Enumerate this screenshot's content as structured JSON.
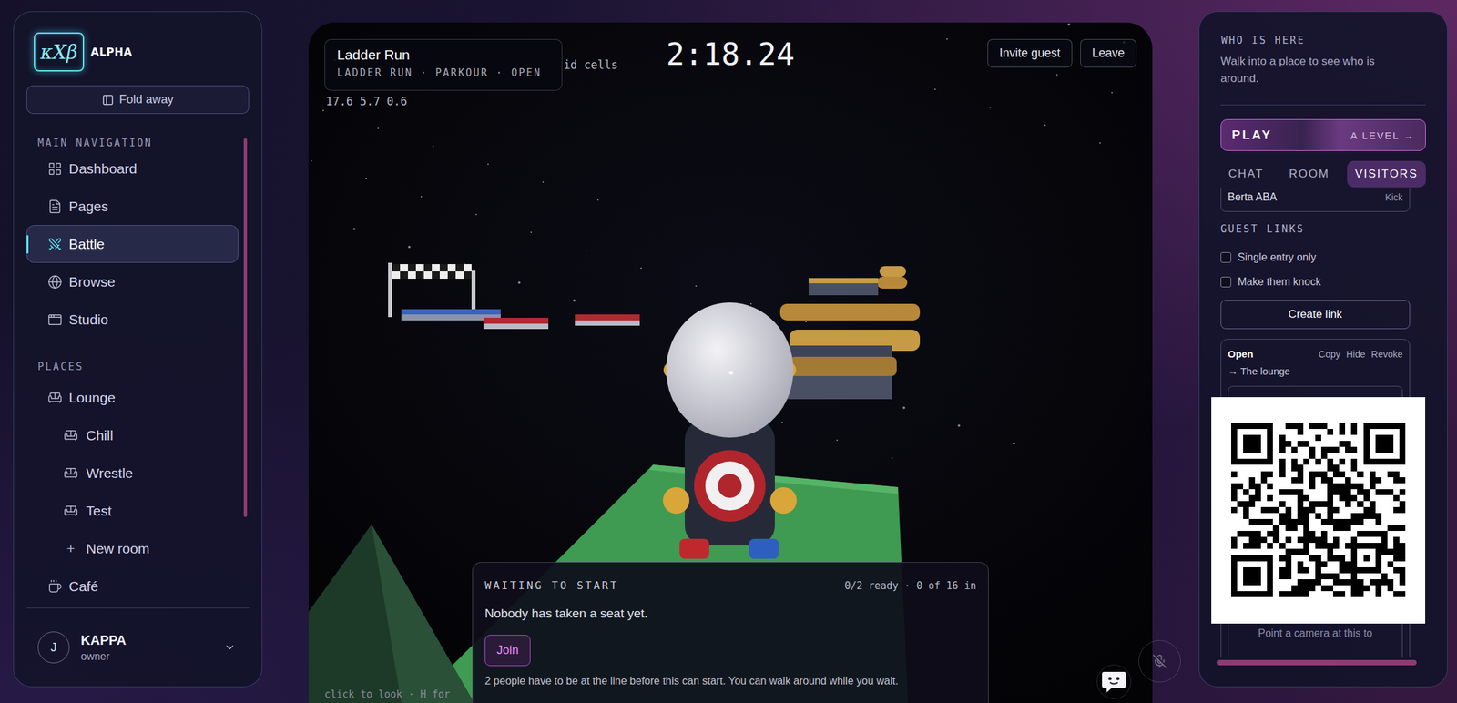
{
  "brand": {
    "logo": "κXβ",
    "tag": "ALPHA"
  },
  "sidebar": {
    "fold": "Fold away",
    "sections": [
      {
        "title": "MAIN NAVIGATION",
        "items": [
          {
            "label": "Dashboard",
            "selected": false,
            "kind": "page",
            "icon": ""
          },
          {
            "label": "Pages",
            "selected": false,
            "kind": "page",
            "icon": ""
          },
          {
            "label": "Battle",
            "selected": true,
            "kind": "page",
            "icon": ""
          },
          {
            "label": "Browse",
            "selected": false,
            "kind": "page",
            "icon": ""
          },
          {
            "label": "Studio",
            "selected": false,
            "kind": "page",
            "icon": ""
          }
        ]
      },
      {
        "title": "PLACES",
        "items": [
          {
            "label": "Lounge",
            "selected": false,
            "kind": "place",
            "icon": ""
          },
          {
            "label": "Chill",
            "selected": false,
            "kind": "room",
            "icon": ""
          },
          {
            "label": "Wrestle",
            "selected": false,
            "kind": "room",
            "icon": ""
          },
          {
            "label": "Test",
            "selected": false,
            "kind": "room",
            "icon": ""
          },
          {
            "label": "New room",
            "selected": false,
            "kind": "add",
            "icon": "+"
          },
          {
            "label": "Café",
            "selected": false,
            "kind": "place",
            "icon": ""
          }
        ]
      }
    ],
    "user": {
      "initial": "J",
      "name": "KAPPA",
      "role": "owner"
    }
  },
  "game": {
    "title": "Ladder Run",
    "subtitle": "LADDER RUN · PARKOUR · OPEN",
    "debug": [
      "id cells",
      "17.6 5.7 0.6"
    ],
    "hint": "click to look · H for",
    "timer": "2:18.24",
    "buttons": [
      "Invite guest",
      "Leave"
    ],
    "lobby": {
      "heading": "WAITING TO START",
      "counts": "0/2 ready · 0 of 16 in",
      "message": "Nobody has taken a seat yet.",
      "join": "Join",
      "note": "2 people have to be at the line before this can start. You can walk around while you wait."
    }
  },
  "panel": {
    "heading": "WHO IS HERE",
    "hint": "Walk into a place to see who is around.",
    "play": {
      "label": "PLAY",
      "action": "A LEVEL →"
    },
    "tabs": [
      {
        "label": "CHAT",
        "selected": false
      },
      {
        "label": "ROOM",
        "selected": false
      },
      {
        "label": "VISITORS",
        "selected": true
      }
    ],
    "visitors": [
      {
        "name": "Berta ABA",
        "action": "Kick"
      }
    ],
    "guest_links": {
      "title": "GUEST LINKS",
      "options": [
        {
          "label": "Single entry only",
          "checked": false
        },
        {
          "label": "Make them knock",
          "checked": false
        }
      ],
      "create": "Create link",
      "links": [
        {
          "status": "Open",
          "actions": [
            "Copy",
            "Hide",
            "Revoke"
          ],
          "target": "→ The lounge",
          "caption": "Point a camera at this to"
        }
      ]
    }
  }
}
